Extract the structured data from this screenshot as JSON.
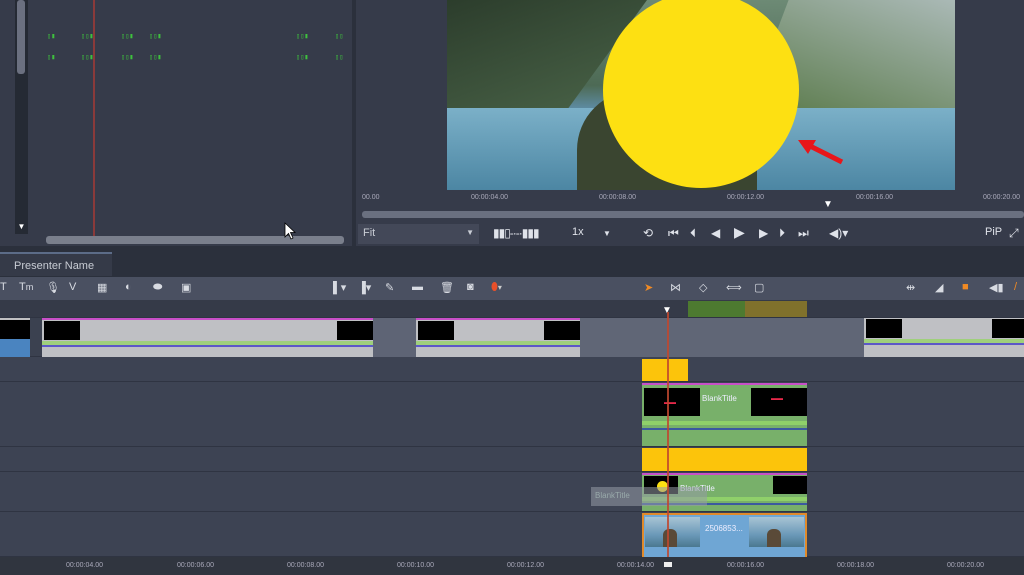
{
  "library": {
    "markers_row1": [
      "▯▮",
      "▯▯▮",
      "▯▯▮",
      "▯▯▮",
      "▯▯▮",
      "▯▯"
    ],
    "markers_row2": [
      "▯▮",
      "▯▯▮",
      "▯▯▮",
      "▯▯▮",
      "▯▯▮",
      "▯▯"
    ]
  },
  "preview": {
    "ruler_ticks": [
      "00.00",
      "00:00:04.00",
      "00:00:08.00",
      "00:00:12.00",
      "00:00:16.00",
      "00:00:20.00"
    ],
    "scrub_position_seconds": 14.5,
    "fit_select": "Fit",
    "speed_select": "1x",
    "pip_label": "PiP",
    "icons": [
      "shuttle-icon",
      "loop-icon",
      "skip-start-icon",
      "prev-frame-icon",
      "step-back-icon",
      "play-icon",
      "step-forward-icon",
      "next-frame-icon",
      "skip-end-icon",
      "volume-icon",
      "fullscreen-icon"
    ]
  },
  "tabs": [
    {
      "label": "Presenter Name"
    }
  ],
  "toolbar": {
    "left_icons": [
      "title-icon",
      "title-small-icon",
      "mic-icon",
      "split-icon",
      "grid-icon",
      "color-icon",
      "link-icon",
      "image-icon"
    ],
    "mid_icons": [
      "marker-in-icon",
      "marker-out-icon",
      "edit-icon",
      "film-icon",
      "trash-icon",
      "snapshot-icon",
      "marker-icon"
    ],
    "right_icons": [
      "pointer-icon",
      "trim-icon",
      "slip-icon",
      "stretch-icon",
      "crop-icon"
    ],
    "far_icons": [
      "ripple-icon",
      "level-icon",
      "magnet-icon",
      "audio-icon",
      "tool-icon"
    ]
  },
  "timeline": {
    "clips": [
      {
        "label": "BlankTitle"
      },
      {
        "label": "BlankTitle"
      },
      {
        "label": "2506853..."
      }
    ],
    "tooltip": "BlankTitle",
    "playhead_seconds": 14.5,
    "ruler_ticks": [
      "00:00:04.00",
      "00:00:06.00",
      "00:00:08.00",
      "00:00:10.00",
      "00:00:12.00",
      "00:00:14.00",
      "00:00:16.00",
      "00:00:18.00",
      "00:00:20.00"
    ]
  },
  "colors": {
    "accent": "#f08a24",
    "title_clip": "#78b06a",
    "yellow_clip": "#fcc40b",
    "video_clip": "#6fa6d4",
    "playhead": "#c0482f"
  }
}
